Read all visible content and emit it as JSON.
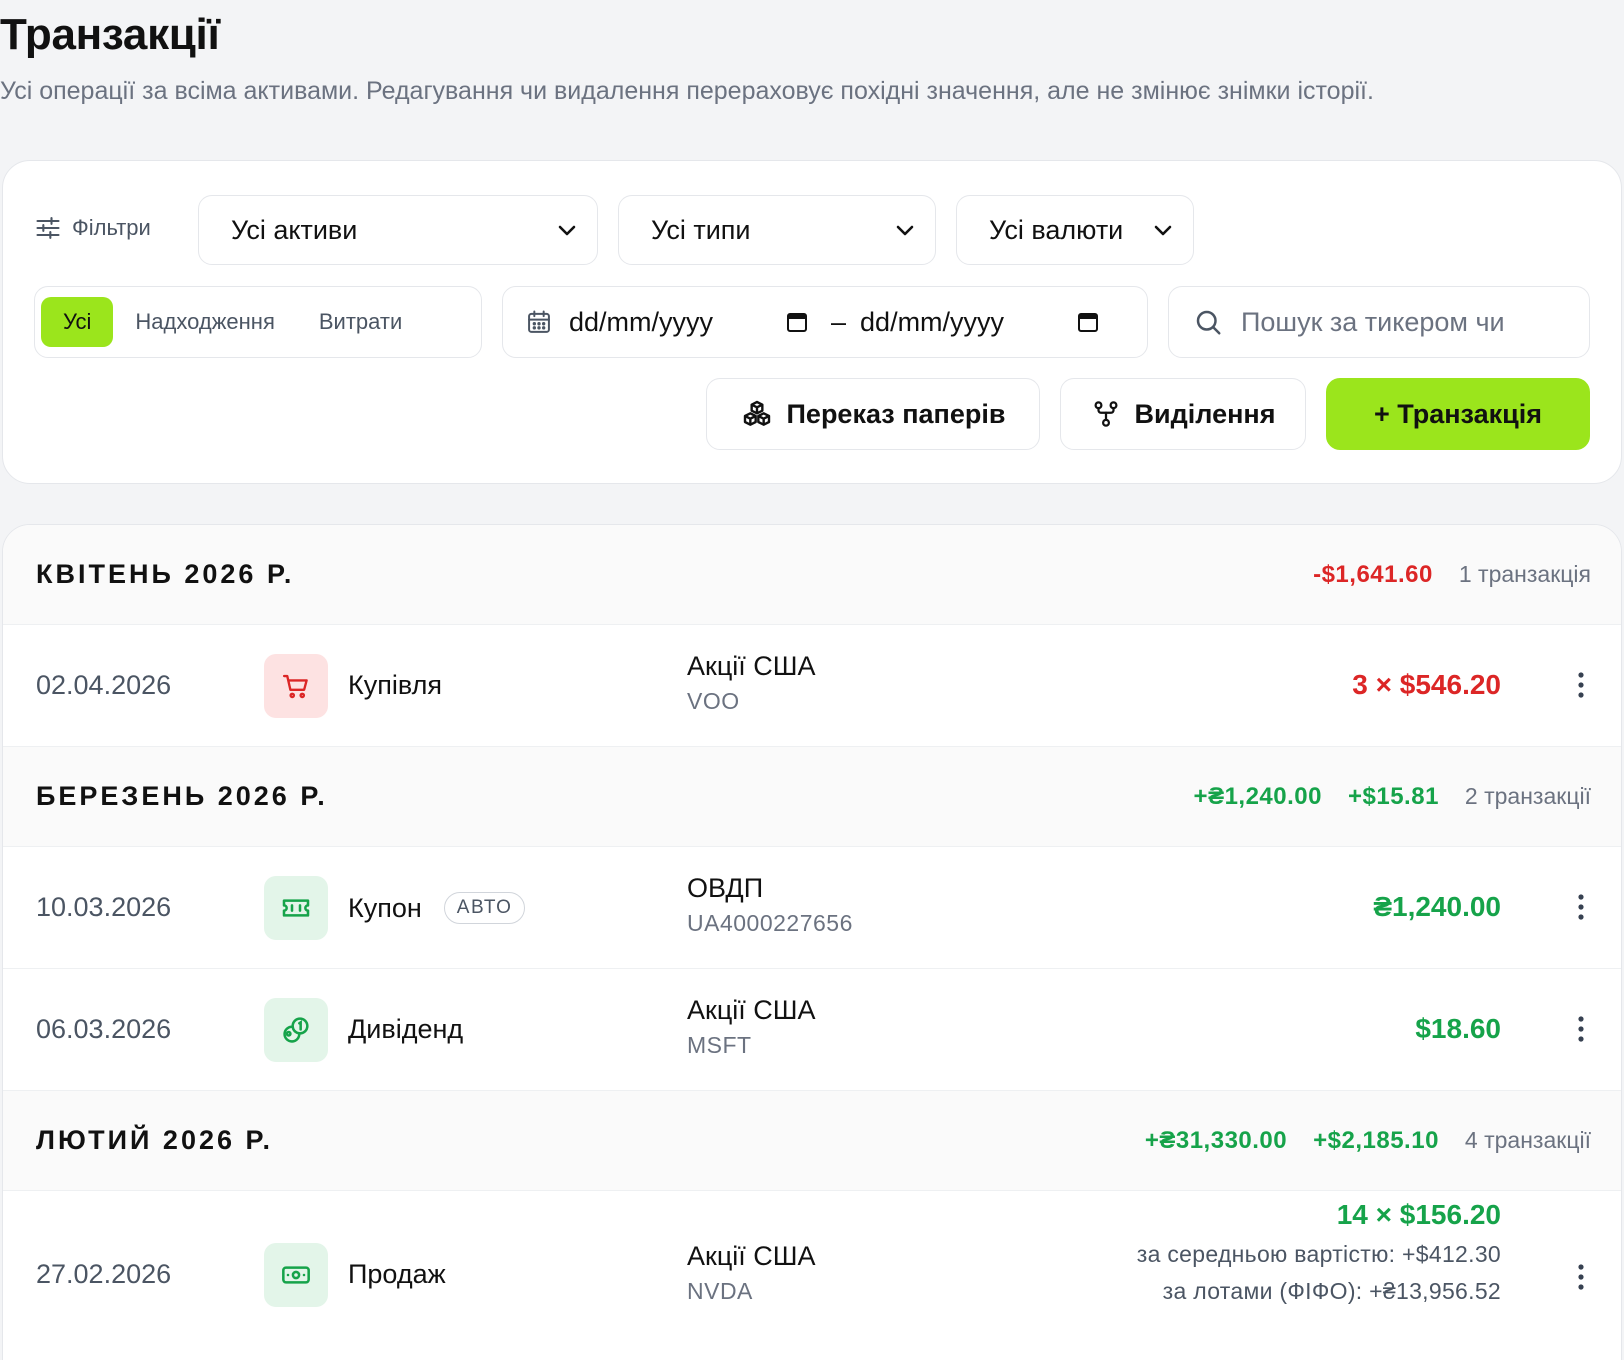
{
  "page": {
    "title": "Транзакції",
    "subtitle": "Усі операції за всіма активами. Редагування чи видалення перераховує похідні значення, але не змінює знімки історії."
  },
  "filters": {
    "label": "Фільтри",
    "asset_select": "Усі активи",
    "type_select": "Усі типи",
    "currency_select": "Усі валюти",
    "direction": {
      "all": "Усі",
      "income": "Надходження",
      "expense": "Витрати",
      "active": "all"
    },
    "date_from": "dd/mm/yyyy",
    "date_sep": "–",
    "date_to": "dd/mm/yyyy",
    "search_placeholder": "Пошук за тикером чи"
  },
  "actions": {
    "transfer": "Переказ паперів",
    "spinoff": "Виділення",
    "add": "+ Транзакція"
  },
  "months": [
    {
      "name": "КВІТЕНЬ 2026 Р.",
      "totals": [
        {
          "value": "-$1,641.60",
          "tone": "neg"
        }
      ],
      "count": "1 транзакція",
      "rows": [
        {
          "date": "02.04.2026",
          "type": "Купівля",
          "icon": "cart-icon",
          "tone": "red",
          "asset": "Акції США",
          "ticker": "VOO",
          "amount": "3 × $546.20",
          "amount_tone": "neg"
        }
      ]
    },
    {
      "name": "БЕРЕЗЕНЬ 2026 Р.",
      "totals": [
        {
          "value": "+₴1,240.00",
          "tone": "pos"
        },
        {
          "value": "+$15.81",
          "tone": "pos"
        }
      ],
      "count": "2 транзакції",
      "rows": [
        {
          "date": "10.03.2026",
          "type": "Купон",
          "badge": "АВТО",
          "icon": "ticket-icon",
          "tone": "green",
          "asset": "ОВДП",
          "ticker": "UA4000227656",
          "amount": "₴1,240.00",
          "amount_tone": "pos"
        },
        {
          "date": "06.03.2026",
          "type": "Дивіденд",
          "icon": "coins-icon",
          "tone": "green",
          "asset": "Акції США",
          "ticker": "MSFT",
          "amount": "$18.60",
          "amount_tone": "pos"
        }
      ]
    },
    {
      "name": "ЛЮТИЙ 2026 Р.",
      "totals": [
        {
          "value": "+₴31,330.00",
          "tone": "pos"
        },
        {
          "value": "+$2,185.10",
          "tone": "pos"
        }
      ],
      "count": "4 транзакції",
      "rows": [
        {
          "date": "27.02.2026",
          "type": "Продаж",
          "icon": "banknote-icon",
          "tone": "green",
          "asset": "Акції США",
          "ticker": "NVDA",
          "amount": "14 × $156.20",
          "amount_tone": "pos",
          "sub1": "за середньою вартістю: +$412.30",
          "sub2": "за лотами (ФІФО): +₴13,956.52"
        }
      ]
    }
  ],
  "colors": {
    "accent": "#9be51c",
    "negative": "#dc2626",
    "positive": "#16a34a"
  }
}
